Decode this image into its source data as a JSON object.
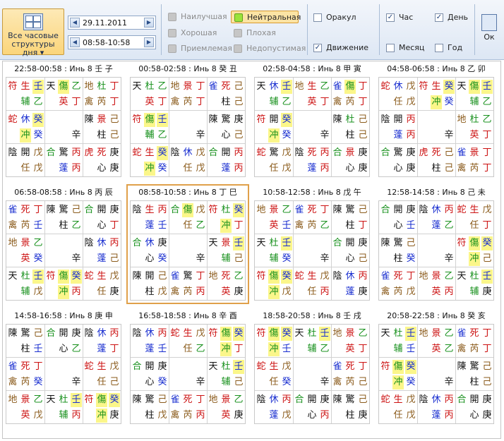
{
  "ribbon": {
    "all_button": {
      "label1": "Все часовые",
      "label2": "структуры дня ▾"
    },
    "date": "29.11.2011",
    "time": "08:58-10:58",
    "filters": [
      {
        "label": "Наилучшая",
        "state": "disabled"
      },
      {
        "label": "Хорошая",
        "state": "disabled"
      },
      {
        "label": "Приемлемая",
        "state": "disabled"
      },
      {
        "label": "Нейтральная",
        "state": "selected"
      },
      {
        "label": "Плохая",
        "state": "disabled"
      },
      {
        "label": "Недопустимая",
        "state": "disabled"
      }
    ],
    "checks1": [
      {
        "label": "Оракул",
        "checked": false
      },
      {
        "label": "Движение",
        "checked": true
      }
    ],
    "checks2": [
      {
        "label": "Час",
        "checked": true
      },
      {
        "label": "День",
        "checked": true
      },
      {
        "label": "Месяц",
        "checked": false
      },
      {
        "label": "Год",
        "checked": false
      }
    ],
    "ok_label": "Ок"
  },
  "boards": [
    {
      "title": "22:58-00:58 : Инь 8 壬 子",
      "cells": [
        [
          "符",
          "生",
          "壬",
          "",
          "辅",
          "乙"
        ],
        [
          "天",
          "傷",
          "乙",
          "",
          "英",
          "丁"
        ],
        [
          "地",
          "杜",
          "丁",
          "禽",
          "芮",
          "丁"
        ],
        [
          "蛇",
          "休",
          "癸",
          "",
          "冲",
          "癸"
        ],
        [
          "",
          "",
          "",
          "",
          "",
          "辛"
        ],
        [
          "陳",
          "景",
          "己",
          "",
          "柱",
          "己"
        ],
        [
          "陰",
          "開",
          "戊",
          "",
          "任",
          "戊"
        ],
        [
          "合",
          "驚",
          "丙",
          "",
          "蓬",
          "丙"
        ],
        [
          "虎",
          "死",
          "庚",
          "",
          "心",
          "庚"
        ]
      ]
    },
    {
      "title": "00:58-02:58 : Инь 8 癸 丑",
      "cells": [
        [
          "天",
          "杜",
          "乙",
          "",
          "英",
          "丁"
        ],
        [
          "地",
          "景",
          "丁",
          "禽",
          "芮",
          "丁"
        ],
        [
          "雀",
          "死",
          "己",
          "",
          "柱",
          "己"
        ],
        [
          "符",
          "傷",
          "壬",
          "",
          "輔",
          "乙"
        ],
        [
          "",
          "",
          "",
          "",
          "",
          "辛"
        ],
        [
          "陳",
          "驚",
          "庚",
          "",
          "心",
          "己"
        ],
        [
          "蛇",
          "生",
          "癸",
          "",
          "冲",
          "癸"
        ],
        [
          "陰",
          "休",
          "戊",
          "",
          "任",
          "戊"
        ],
        [
          "合",
          "開",
          "丙",
          "",
          "蓬",
          "丙"
        ]
      ]
    },
    {
      "title": "02:58-04:58 : Инь 8 甲 寅",
      "cells": [
        [
          "天",
          "休",
          "壬",
          "",
          "辅",
          "乙"
        ],
        [
          "地",
          "生",
          "乙",
          "",
          "英",
          "丁"
        ],
        [
          "雀",
          "傷",
          "丁",
          "禽",
          "芮",
          "丁"
        ],
        [
          "符",
          "開",
          "癸",
          "",
          "冲",
          "癸"
        ],
        [
          "",
          "",
          "",
          "",
          "",
          "辛"
        ],
        [
          "陳",
          "杜",
          "己",
          "",
          "柱",
          "己"
        ],
        [
          "蛇",
          "驚",
          "戊",
          "",
          "任",
          "戊"
        ],
        [
          "陰",
          "死",
          "丙",
          "",
          "蓬",
          "丙"
        ],
        [
          "合",
          "景",
          "庚",
          "",
          "心",
          "庚"
        ]
      ]
    },
    {
      "title": "04:58-06:58 : Инь 8 乙 卯",
      "cells": [
        [
          "蛇",
          "休",
          "戊",
          "",
          "任",
          "戊"
        ],
        [
          "符",
          "生",
          "癸",
          "",
          "冲",
          "癸"
        ],
        [
          "天",
          "傷",
          "壬",
          "",
          "辅",
          "乙"
        ],
        [
          "陰",
          "開",
          "丙",
          "",
          "蓬",
          "丙"
        ],
        [
          "",
          "",
          "",
          "",
          "",
          "辛"
        ],
        [
          "地",
          "杜",
          "乙",
          "",
          "英",
          "丁"
        ],
        [
          "合",
          "驚",
          "庚",
          "",
          "心",
          "庚"
        ],
        [
          "虎",
          "死",
          "己",
          "",
          "柱",
          "己"
        ],
        [
          "雀",
          "景",
          "丁",
          "禽",
          "芮",
          "丁"
        ]
      ]
    },
    {
      "title": "06:58-08:58 : Инь 8 丙 辰",
      "cells": [
        [
          "雀",
          "死",
          "丁",
          "禽",
          "芮",
          "壬"
        ],
        [
          "陳",
          "驚",
          "己",
          "",
          "柱",
          "乙"
        ],
        [
          "合",
          "開",
          "庚",
          "",
          "心",
          "丁"
        ],
        [
          "地",
          "景",
          "乙",
          "",
          "英",
          "癸"
        ],
        [
          "",
          "",
          "",
          "",
          "",
          "辛"
        ],
        [
          "陰",
          "休",
          "丙",
          "",
          "蓬",
          "己"
        ],
        [
          "天",
          "杜",
          "壬",
          "",
          "辅",
          "戊"
        ],
        [
          "符",
          "傷",
          "癸",
          "",
          "冲",
          "丙"
        ],
        [
          "蛇",
          "生",
          "戊",
          "",
          "任",
          "庚"
        ]
      ]
    },
    {
      "title": "08:58-10:58 : Инь 8 丁 巳",
      "cells": [
        [
          "陰",
          "生",
          "丙",
          "",
          "蓬",
          "壬"
        ],
        [
          "合",
          "傷",
          "戊",
          "",
          "任",
          "乙"
        ],
        [
          "符",
          "杜",
          "癸",
          "",
          "冲",
          "丁"
        ],
        [
          "合",
          "休",
          "庚",
          "",
          "心",
          "癸"
        ],
        [
          "",
          "",
          "",
          "",
          "",
          "辛"
        ],
        [
          "天",
          "景",
          "壬",
          "",
          "辅",
          "己"
        ],
        [
          "陳",
          "開",
          "己",
          "",
          "柱",
          "戊"
        ],
        [
          "雀",
          "驚",
          "丁",
          "禽",
          "芮",
          "丙"
        ],
        [
          "地",
          "死",
          "乙",
          "",
          "英",
          "庚"
        ]
      ]
    },
    {
      "title": "10:58-12:58 : Инь 8 戊 午",
      "cells": [
        [
          "地",
          "景",
          "乙",
          "",
          "英",
          "壬"
        ],
        [
          "雀",
          "死",
          "丁",
          "禽",
          "芮",
          "乙"
        ],
        [
          "陳",
          "驚",
          "己",
          "",
          "柱",
          "丁"
        ],
        [
          "天",
          "杜",
          "壬",
          "",
          "辅",
          "癸"
        ],
        [
          "",
          "",
          "",
          "",
          "",
          "辛"
        ],
        [
          "合",
          "開",
          "庚",
          "",
          "心",
          "己"
        ],
        [
          "符",
          "傷",
          "癸",
          "",
          "冲",
          "戊"
        ],
        [
          "蛇",
          "生",
          "戊",
          "",
          "任",
          "丙"
        ],
        [
          "陰",
          "休",
          "丙",
          "",
          "蓬",
          "庚"
        ]
      ]
    },
    {
      "title": "12:58-14:58 : Инь 8 己 未",
      "cells": [
        [
          "合",
          "開",
          "庚",
          "",
          "心",
          "壬"
        ],
        [
          "陰",
          "休",
          "丙",
          "",
          "蓬",
          "乙"
        ],
        [
          "蛇",
          "生",
          "戊",
          "",
          "任",
          "丁"
        ],
        [
          "陳",
          "驚",
          "己",
          "",
          "柱",
          "癸"
        ],
        [
          "",
          "",
          "",
          "",
          "",
          "辛"
        ],
        [
          "符",
          "傷",
          "癸",
          "",
          "冲",
          "己"
        ],
        [
          "雀",
          "死",
          "丁",
          "禽",
          "芮",
          "戊"
        ],
        [
          "地",
          "景",
          "乙",
          "",
          "英",
          "丙"
        ],
        [
          "天",
          "杜",
          "壬",
          "",
          "辅",
          "庚"
        ]
      ]
    },
    {
      "title": "14:58-16:58 : Инь 8 庚 申",
      "cells": [
        [
          "陳",
          "驚",
          "己",
          "",
          "柱",
          "壬"
        ],
        [
          "合",
          "開",
          "庚",
          "",
          "心",
          "乙"
        ],
        [
          "陰",
          "休",
          "丙",
          "",
          "蓬",
          "丁"
        ],
        [
          "雀",
          "死",
          "丁",
          "禽",
          "芮",
          "癸"
        ],
        [
          "",
          "",
          "",
          "",
          "",
          "辛"
        ],
        [
          "蛇",
          "生",
          "戊",
          "",
          "任",
          "己"
        ],
        [
          "地",
          "景",
          "乙",
          "",
          "英",
          "戊"
        ],
        [
          "天",
          "杜",
          "壬",
          "",
          "辅",
          "丙"
        ],
        [
          "符",
          "傷",
          "癸",
          "",
          "冲",
          "庚"
        ]
      ]
    },
    {
      "title": "16:58-18:58 : Инь 8 辛 酉",
      "cells": [
        [
          "陰",
          "休",
          "丙",
          "",
          "蓬",
          "壬"
        ],
        [
          "蛇",
          "生",
          "戊",
          "",
          "任",
          "乙"
        ],
        [
          "符",
          "傷",
          "癸",
          "",
          "冲",
          "丁"
        ],
        [
          "合",
          "開",
          "庚",
          "",
          "心",
          "癸"
        ],
        [
          "",
          "",
          "",
          "",
          "",
          "辛"
        ],
        [
          "天",
          "杜",
          "壬",
          "",
          "辅",
          "己"
        ],
        [
          "陳",
          "驚",
          "己",
          "",
          "柱",
          "戊"
        ],
        [
          "雀",
          "死",
          "丁",
          "禽",
          "芮",
          "丙"
        ],
        [
          "地",
          "景",
          "乙",
          "",
          "英",
          "庚"
        ]
      ]
    },
    {
      "title": "18:58-20:58 : Инь 8 壬 戌",
      "cells": [
        [
          "符",
          "傷",
          "癸",
          "",
          "冲",
          "壬"
        ],
        [
          "天",
          "杜",
          "壬",
          "",
          "辅",
          "乙"
        ],
        [
          "地",
          "景",
          "乙",
          "",
          "英",
          "丁"
        ],
        [
          "蛇",
          "生",
          "戊",
          "",
          "任",
          "癸"
        ],
        [
          "",
          "",
          "",
          "",
          "",
          "辛"
        ],
        [
          "雀",
          "死",
          "丁",
          "禽",
          "芮",
          "己"
        ],
        [
          "陰",
          "休",
          "丙",
          "",
          "蓬",
          "戊"
        ],
        [
          "合",
          "開",
          "庚",
          "",
          "心",
          "丙"
        ],
        [
          "陳",
          "驚",
          "己",
          "",
          "柱",
          "庚"
        ]
      ]
    },
    {
      "title": "20:58-22:58 : Инь 8 癸 亥",
      "cells": [
        [
          "天",
          "杜",
          "壬",
          "",
          "辅",
          "壬"
        ],
        [
          "地",
          "景",
          "乙",
          "",
          "英",
          "乙"
        ],
        [
          "雀",
          "死",
          "丁",
          "禽",
          "芮",
          "丁"
        ],
        [
          "符",
          "傷",
          "癸",
          "",
          "冲",
          "癸"
        ],
        [
          "",
          "",
          "",
          "",
          "",
          "辛"
        ],
        [
          "陳",
          "驚",
          "己",
          "",
          "柱",
          "己"
        ],
        [
          "蛇",
          "生",
          "戊",
          "",
          "任",
          "戊"
        ],
        [
          "陰",
          "休",
          "丙",
          "",
          "蓬",
          "丙"
        ],
        [
          "合",
          "開",
          "庚",
          "",
          "心",
          "庚"
        ]
      ]
    }
  ],
  "selected_board": 5
}
